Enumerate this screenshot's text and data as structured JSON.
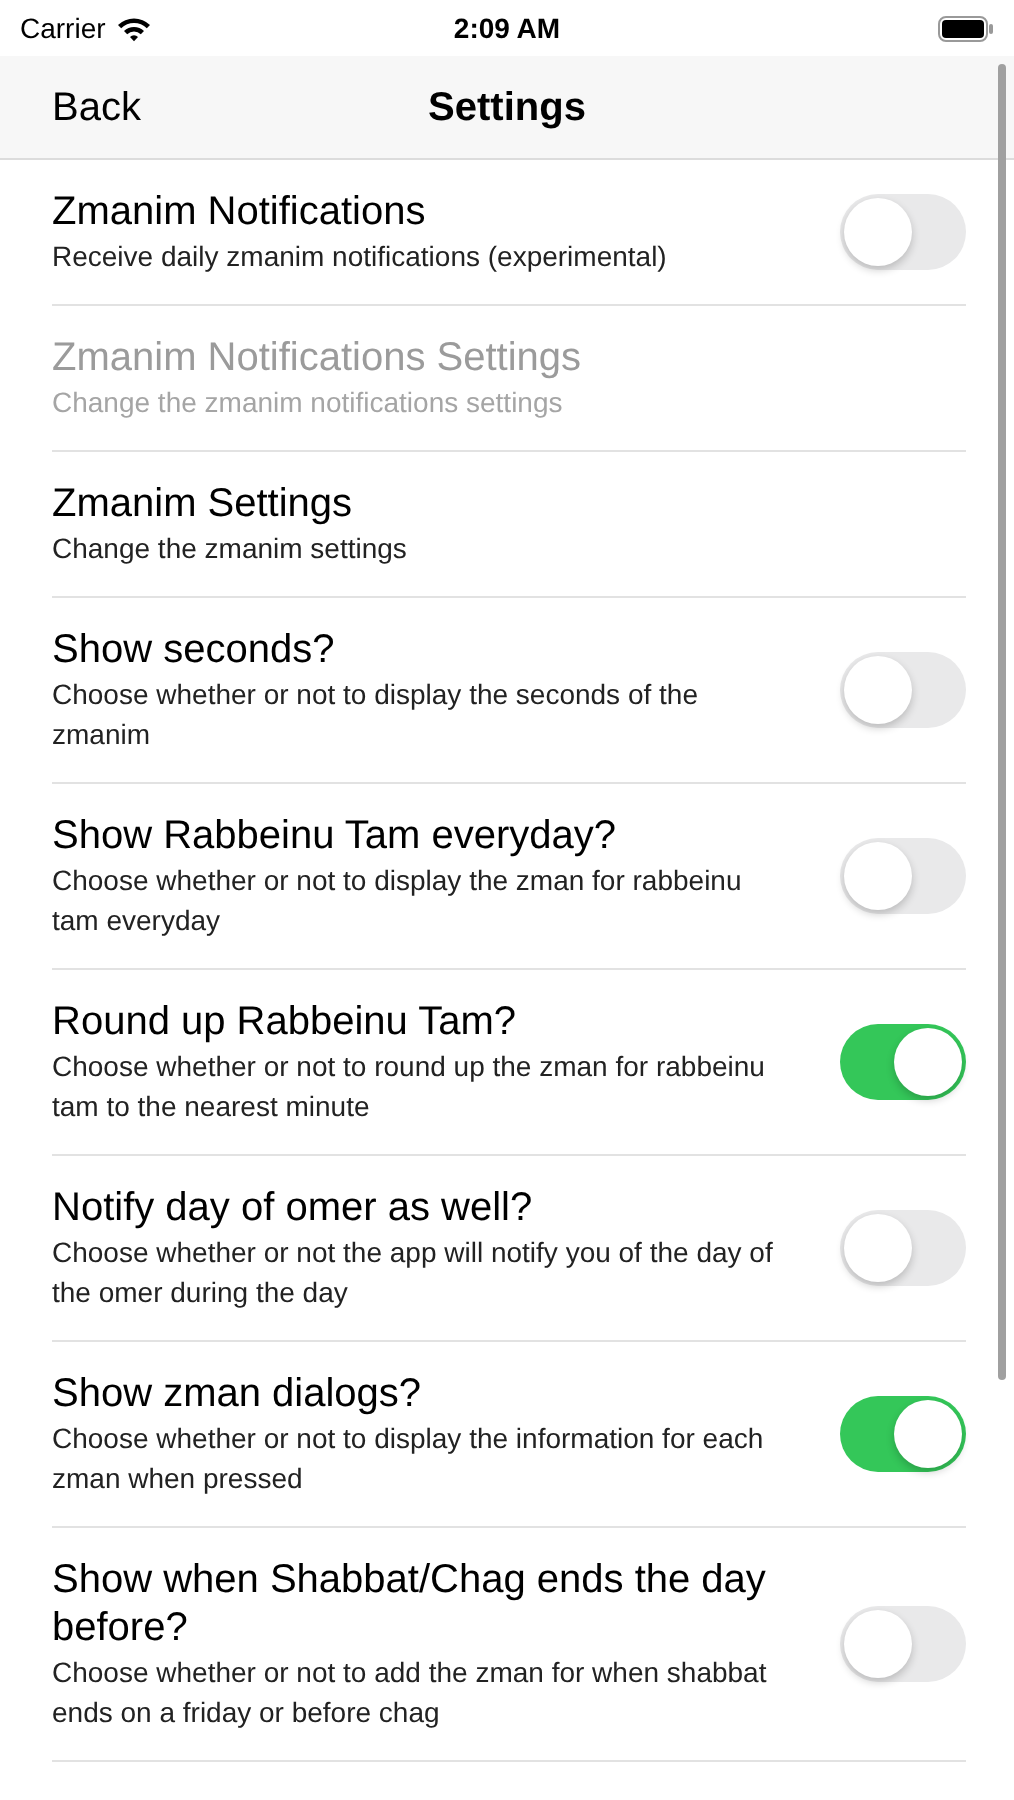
{
  "status_bar": {
    "carrier": "Carrier",
    "time": "2:09 AM"
  },
  "nav_bar": {
    "back": "Back",
    "title": "Settings"
  },
  "settings": [
    {
      "kind": "toggle",
      "title": "Zmanim Notifications",
      "subtitle": "Receive daily zmanim notifications (experimental)",
      "on": false,
      "disabled": false
    },
    {
      "kind": "link",
      "title": "Zmanim Notifications Settings",
      "subtitle": "Change the zmanim notifications settings",
      "disabled": true
    },
    {
      "kind": "link",
      "title": "Zmanim Settings",
      "subtitle": "Change the zmanim settings",
      "disabled": false
    },
    {
      "kind": "toggle",
      "title": "Show seconds?",
      "subtitle": "Choose whether or not to display the seconds of the zmanim",
      "on": false,
      "disabled": false
    },
    {
      "kind": "toggle",
      "title": "Show Rabbeinu Tam everyday?",
      "subtitle": "Choose whether or not to display the zman for rabbeinu tam everyday",
      "on": false,
      "disabled": false
    },
    {
      "kind": "toggle",
      "title": "Round up Rabbeinu Tam?",
      "subtitle": "Choose whether or not to round up the zman for rabbeinu tam to the nearest minute",
      "on": true,
      "disabled": false
    },
    {
      "kind": "toggle",
      "title": "Notify day of omer as well?",
      "subtitle": "Choose whether or not the app will notify you of the day of the omer during the day",
      "on": false,
      "disabled": false
    },
    {
      "kind": "toggle",
      "title": "Show zman dialogs?",
      "subtitle": "Choose whether or not to display the information for each zman when pressed",
      "on": true,
      "disabled": false
    },
    {
      "kind": "toggle",
      "title": "Show when Shabbat/Chag ends the day before?",
      "subtitle": "Choose whether or not to add the zman for when shabbat ends on a friday or before chag",
      "on": false,
      "disabled": false
    }
  ]
}
